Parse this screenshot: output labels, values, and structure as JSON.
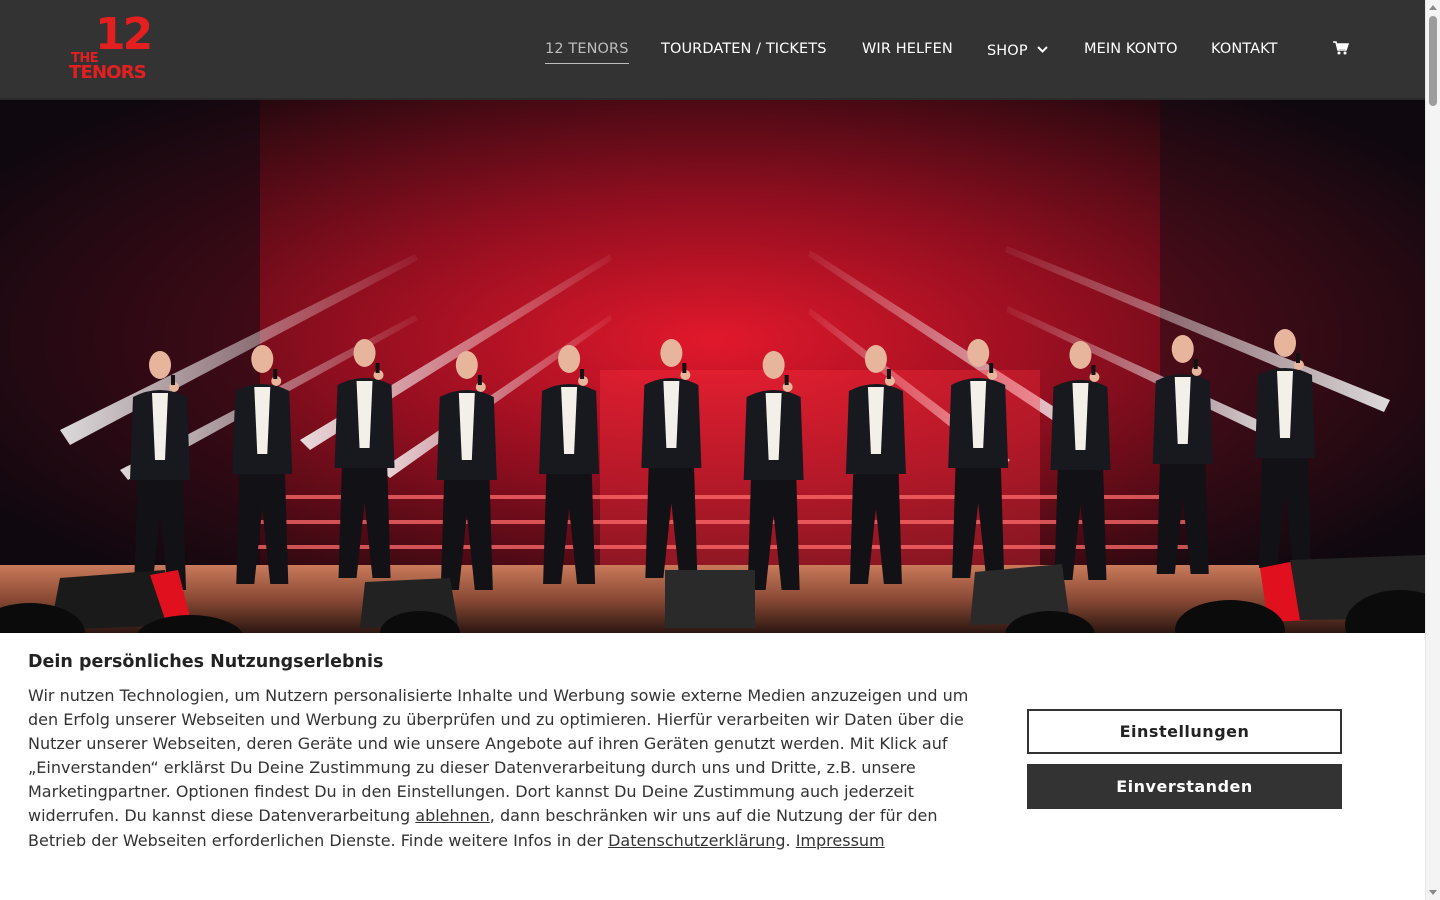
{
  "brand": {
    "logo_the": "THE",
    "logo_number": "12",
    "logo_tenors": "TENORS",
    "accent_color": "#e3201f"
  },
  "nav": {
    "items": [
      {
        "label": "12 TENORS",
        "active": true
      },
      {
        "label": "TOURDATEN / TICKETS",
        "active": false
      },
      {
        "label": "WIR HELFEN",
        "active": false
      },
      {
        "label": "SHOP",
        "active": false,
        "has_dropdown": true
      },
      {
        "label": "MEIN KONTO",
        "active": false
      },
      {
        "label": "KONTAKT",
        "active": false
      }
    ],
    "cart_icon": "cart-icon",
    "dropdown_icon": "chevron-down-icon"
  },
  "hero": {
    "image": "stage-photo",
    "performers_count": 12
  },
  "cookie": {
    "title": "Dein persönliches Nutzungserlebnis",
    "text_part1": "Wir nutzen Technologien, um Nutzern personalisierte Inhalte und Werbung sowie externe Medien anzuzeigen und um den Erfolg unserer Webseiten und Werbung zu überprüfen und zu optimieren. Hierfür verarbeiten wir Daten über die Nutzer unserer Webseiten, deren Geräte und wie unsere Angebote auf ihren Geräten genutzt werden. Mit Klick auf „Einverstanden“ erklärst Du Deine Zustimmung zu dieser Datenverarbeitung durch uns und Dritte, z.B. unsere Marketingpartner. Optionen findest Du in den Einstellungen. Dort kannst Du Deine Zustimmung auch jederzeit widerrufen. Du kannst diese Datenverarbeitung ",
    "link_decline": "ablehnen",
    "text_part2": ", dann beschränken wir uns auf die Nutzung der für den Betrieb der Webseiten erforderlichen Dienste. Finde weitere Infos in der ",
    "link_privacy": "Datenschutzerklärung",
    "text_part3": ". ",
    "link_imprint": "Impressum",
    "btn_settings": "Einstellungen",
    "btn_accept": "Einverstanden"
  },
  "colors": {
    "header_bg": "#333333",
    "button_dark": "#333333"
  }
}
